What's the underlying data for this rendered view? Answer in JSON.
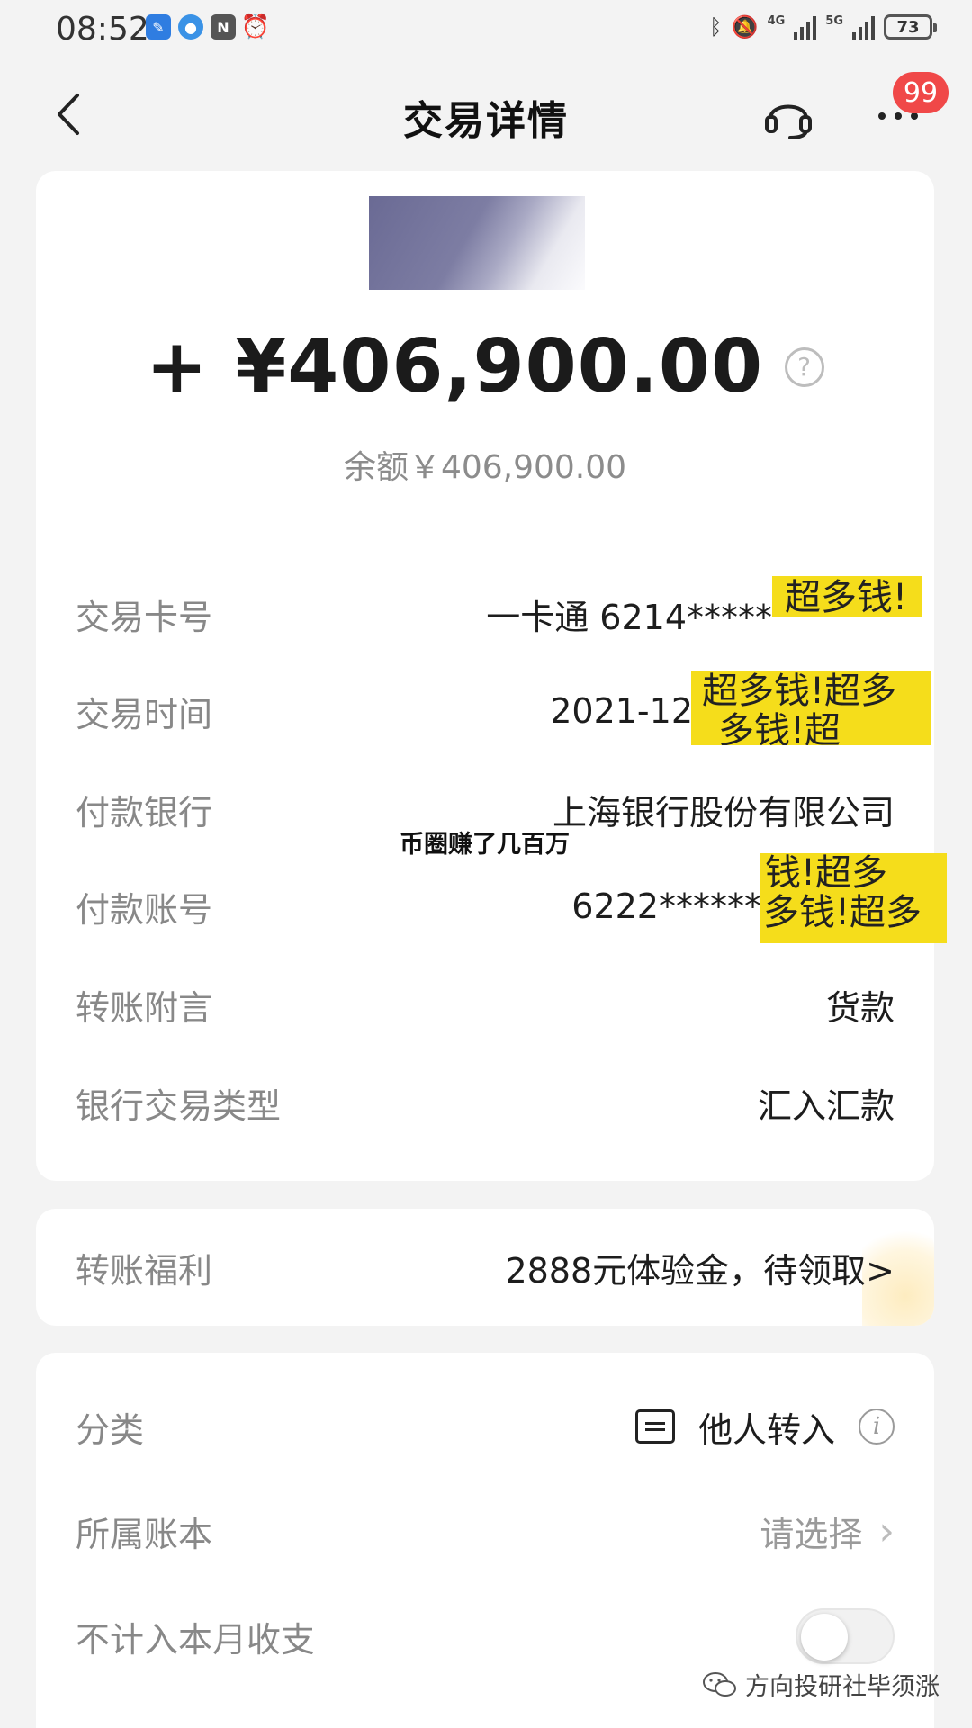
{
  "status_bar": {
    "time": "08:52",
    "network_labels": [
      "4G",
      "5G"
    ],
    "battery": "73"
  },
  "nav": {
    "title": "交易详情",
    "badge": "99"
  },
  "summary": {
    "amount": "+ ¥406,900.00",
    "help_symbol": "?",
    "balance": "余额￥406,900.00"
  },
  "details": [
    {
      "label": "交易卡号",
      "value": "一卡通 6214*****"
    },
    {
      "label": "交易时间",
      "value": "2021-12"
    },
    {
      "label": "付款银行",
      "value": "上海银行股份有限公司"
    },
    {
      "label": "付款账号",
      "value": "6222******"
    },
    {
      "label": "转账附言",
      "value": "货款"
    },
    {
      "label": "银行交易类型",
      "value": "汇入汇款"
    }
  ],
  "overlay_caption": "币圈赚了几百万",
  "stickers": {
    "line1": "超多钱!",
    "line2a": "超多钱!超多",
    "line2b": "多钱!超",
    "line3a": "钱!超多",
    "line3b": "多钱!超多"
  },
  "benefit": {
    "label": "转账福利",
    "value": "2888元体验金，待领取>"
  },
  "meta": {
    "category_label": "分类",
    "category_value": "他人转入",
    "info_symbol": "i",
    "ledger_label": "所属账本",
    "ledger_value": "请选择",
    "exclude_label": "不计入本月收支",
    "exclude_on": false
  },
  "watermark": "方向投研社毕须涨"
}
